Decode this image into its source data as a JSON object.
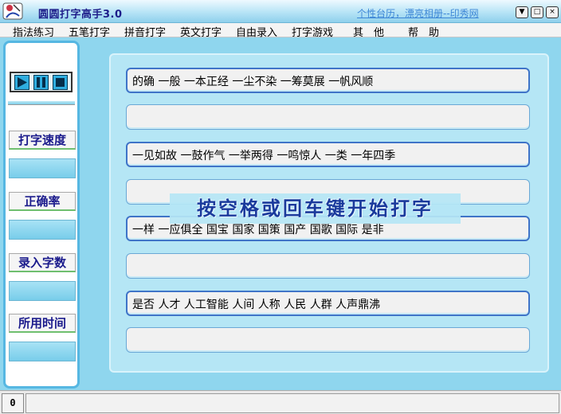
{
  "window": {
    "title": "圆圆打字高手3.0",
    "link_text": "个性台历，漂亮相册--印秀网",
    "buttons": {
      "menu": "▼",
      "restore": "□",
      "close": "×"
    }
  },
  "menu": {
    "items": [
      "指法练习",
      "五笔打字",
      "拼音打字",
      "英文打字",
      "自由录入",
      "打字游戏",
      "其　他",
      "帮　助"
    ]
  },
  "controls": {
    "play": "play-icon",
    "pause": "pause-icon",
    "stop": "stop-icon",
    "accent": "#2faee0"
  },
  "stats": {
    "speed_label": "打字速度",
    "accuracy_label": "正确率",
    "chars_label": "录入字数",
    "time_label": "所用时间"
  },
  "lines": [
    {
      "source": "的确 一般 一本正经 一尘不染 一筹莫展 一帆风顺",
      "input": ""
    },
    {
      "source": "一见如故 一鼓作气 一举两得 一鸣惊人 一类 一年四季",
      "input": ""
    },
    {
      "source": "一样 一应俱全 国宝 国家 国策 国产 国歌 国际 是非",
      "input": ""
    },
    {
      "source": "是否 人才 人工智能 人间 人称 人民 人群 人声鼎沸",
      "input": ""
    }
  ],
  "hint": "按空格或回车键开始打字",
  "status": {
    "count": "0",
    "message": ""
  }
}
